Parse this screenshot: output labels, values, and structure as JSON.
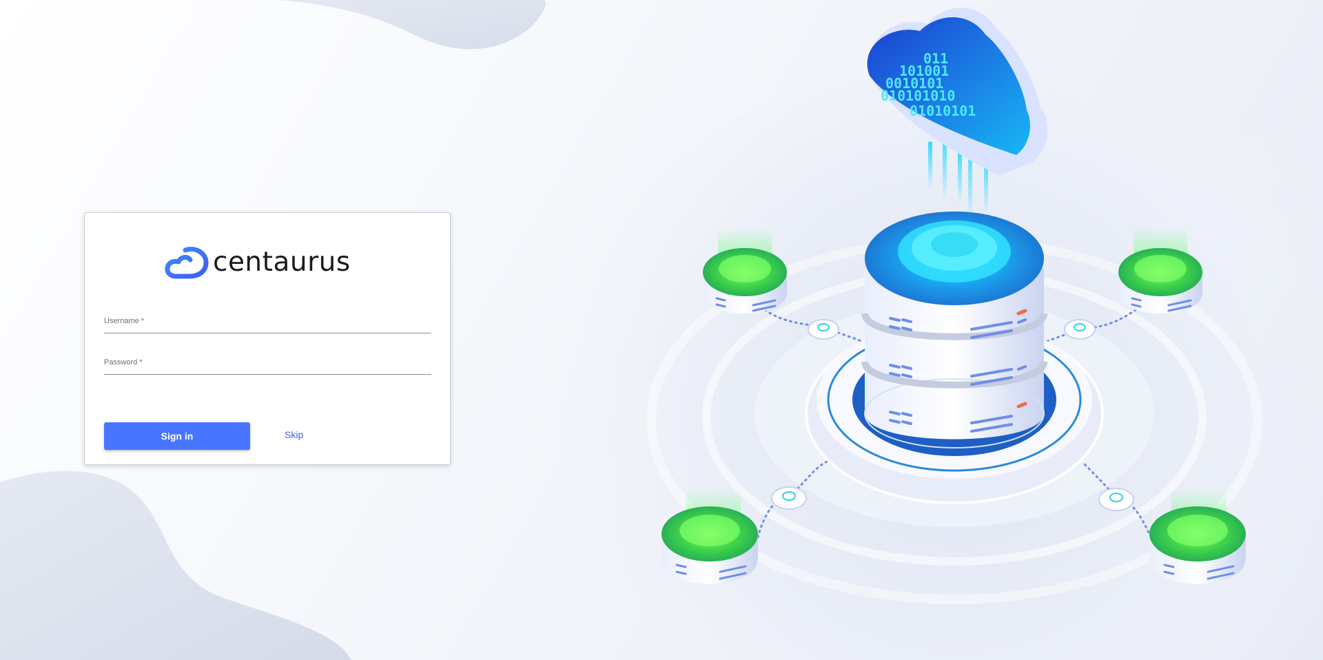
{
  "brand": {
    "name": "centaurus",
    "accent_color": "#4775ff",
    "logo_icon": "cloud-logo-icon"
  },
  "login_form": {
    "username_label": "Username *",
    "username_value": "",
    "password_label": "Password *",
    "password_value": "",
    "signin_label": "Sign in",
    "skip_label": "Skip"
  },
  "illustration": {
    "cloud_binary_text": [
      "011",
      "101001",
      "0010101",
      "010101010",
      "01010101"
    ],
    "description_icon": "cloud-server-network-illustration"
  }
}
